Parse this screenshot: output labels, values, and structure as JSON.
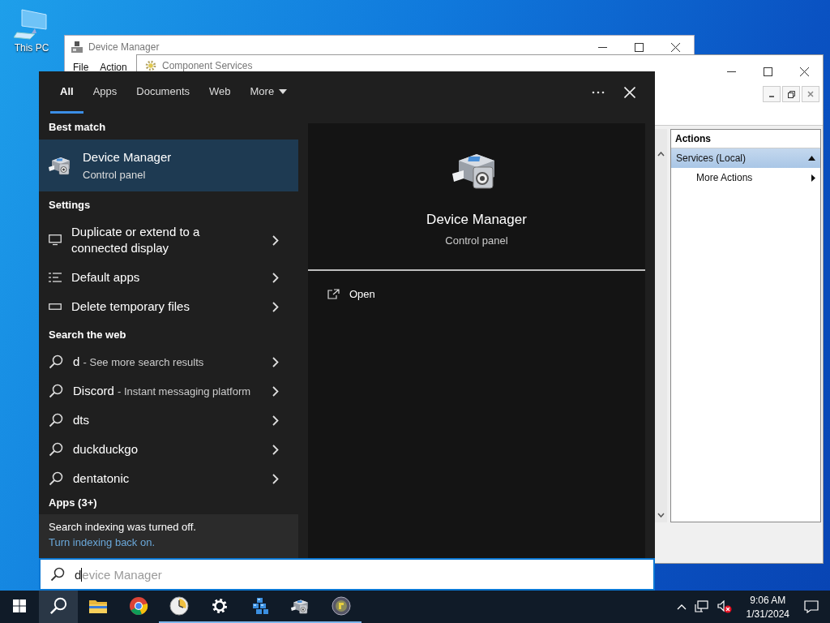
{
  "desktop": {
    "icons": [
      {
        "label": "This PC"
      }
    ]
  },
  "windows": [
    {
      "title": "Device Manager",
      "menu": [
        "File",
        "Action"
      ]
    },
    {
      "title": "Component Services",
      "actions_pane": {
        "title": "Actions",
        "items": [
          {
            "kind": "group",
            "label": "Services (Local)",
            "selected": true
          },
          {
            "kind": "action",
            "label": "More Actions",
            "selected": false
          }
        ]
      }
    }
  ],
  "search": {
    "tabs": [
      {
        "label": "All",
        "selected": true,
        "has_menu": false
      },
      {
        "label": "Apps",
        "selected": false,
        "has_menu": false
      },
      {
        "label": "Documents",
        "selected": false,
        "has_menu": false
      },
      {
        "label": "Web",
        "selected": false,
        "has_menu": false
      },
      {
        "label": "More",
        "selected": false,
        "has_menu": true
      }
    ],
    "best_match": {
      "heading": "Best match",
      "title": "Device Manager",
      "subtitle": "Control panel",
      "selected": true
    },
    "settings": {
      "heading": "Settings",
      "items": [
        {
          "kind": "display",
          "label": "Duplicate or extend to a connected display"
        },
        {
          "kind": "apps",
          "label": "Default apps"
        },
        {
          "kind": "storage",
          "label": "Delete temporary files"
        }
      ]
    },
    "web": {
      "heading": "Search the web",
      "items": [
        {
          "query": "d",
          "note": "- See more search results"
        },
        {
          "query": "Discord",
          "note": "- Instant messaging platform"
        },
        {
          "query": "dts"
        },
        {
          "query": "duckduckgo"
        },
        {
          "query": "dentatonic"
        }
      ]
    },
    "apps_heading": "Apps (3+)",
    "notice": {
      "text": "Search indexing was turned off.",
      "link": "Turn indexing back on."
    },
    "preview": {
      "title": "Device Manager",
      "subtitle": "Control panel",
      "actions": [
        {
          "label": "Open"
        }
      ]
    },
    "search_box": {
      "value": "d",
      "completion": "evice Manager"
    }
  },
  "taskbar": {
    "items": [
      {
        "kind": "start",
        "selected": false,
        "running": false
      },
      {
        "kind": "search",
        "selected": true,
        "running": false
      },
      {
        "kind": "explorer",
        "selected": false,
        "running": false
      },
      {
        "kind": "browser",
        "selected": false,
        "running": false
      },
      {
        "kind": "clock",
        "selected": false,
        "running": true
      },
      {
        "kind": "settings",
        "selected": false,
        "running": true
      },
      {
        "kind": "services",
        "selected": false,
        "running": true
      },
      {
        "kind": "device",
        "selected": false,
        "running": true
      },
      {
        "kind": "globe",
        "selected": false,
        "running": true
      }
    ],
    "clock": {
      "time": "9:06 AM",
      "date": "1/31/2024"
    }
  }
}
